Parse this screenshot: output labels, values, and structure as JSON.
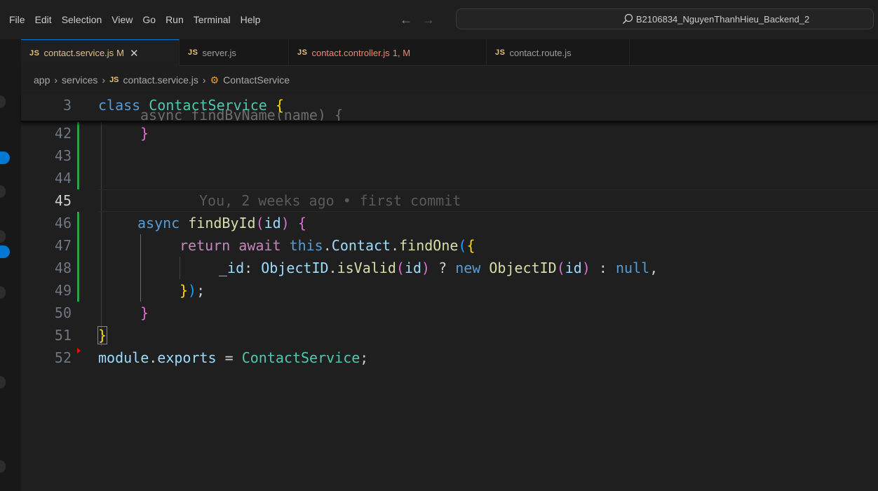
{
  "menu": [
    "File",
    "Edit",
    "Selection",
    "View",
    "Go",
    "Run",
    "Terminal",
    "Help"
  ],
  "nav": {
    "back": "←",
    "forward": "→"
  },
  "search": {
    "text": "B2106834_NguyenThanhHieu_Backend_2",
    "icon": "search-icon"
  },
  "tabs": [
    {
      "badge": "JS",
      "label": "contact.service.js",
      "status": "M",
      "close": "✕",
      "active": true
    },
    {
      "badge": "JS",
      "label": "server.js",
      "status": "",
      "close": "",
      "active": false
    },
    {
      "badge": "JS",
      "label": "contact.controller.js",
      "status": "1, M",
      "close": "",
      "active": false
    },
    {
      "badge": "JS",
      "label": "contact.route.js",
      "status": "",
      "close": "",
      "active": false
    }
  ],
  "breadcrumb": {
    "folder1": "app",
    "folder2": "services",
    "badge": "JS",
    "file": "contact.service.js",
    "symbol": "ContactService",
    "sep": "›"
  },
  "editor": {
    "sticky": {
      "line_number": "3",
      "kw": "class",
      "name": "ContactService",
      "brace": "{"
    },
    "sticky_ghost": "async findByName(name) {",
    "lines": [
      {
        "n": "42"
      },
      {
        "n": "43"
      },
      {
        "n": "44"
      },
      {
        "n": "45",
        "blame": "You, 2 weeks ago • first commit"
      },
      {
        "n": "46"
      },
      {
        "n": "47"
      },
      {
        "n": "48"
      },
      {
        "n": "49"
      },
      {
        "n": "50"
      },
      {
        "n": "51"
      },
      {
        "n": "52"
      }
    ],
    "tokens": {
      "l42_brace": "}",
      "l46_async": "async",
      "l46_fn": "findById",
      "l46_open": "(",
      "l46_param": "id",
      "l46_close": ")",
      "l46_brace": "{",
      "l47_return": "return",
      "l47_await": "await",
      "l47_this": "this",
      "l47_dot": ".",
      "l47_contact": "Contact",
      "l47_dot2": ".",
      "l47_fn": "findOne",
      "l47_open": "(",
      "l47_brace": "{",
      "l48_key": "_id",
      "l48_colon": ": ",
      "l48_obj": "ObjectID",
      "l48_dot": ".",
      "l48_fn": "isValid",
      "l48_open": "(",
      "l48_param": "id",
      "l48_close": ")",
      "l48_q": " ? ",
      "l48_new": "new",
      "l48_obj2": "ObjectID",
      "l48_open2": "(",
      "l48_param2": "id",
      "l48_close2": ")",
      "l48_colon2": " : ",
      "l48_null": "null",
      "l48_comma": ",",
      "l49_brace": "}",
      "l49_paren": ")",
      "l49_semi": ";",
      "l50_brace": "}",
      "l51_brace": "}",
      "l52_module": "module",
      "l52_dot": ".",
      "l52_exports": "exports",
      "l52_eq": " = ",
      "l52_cls": "ContactService",
      "l52_semi": ";"
    }
  },
  "colors": {
    "accent": "#0078d4",
    "git_added": "#2ea043",
    "modified_tab": "#e2c08d",
    "error_tab": "#f48771"
  }
}
